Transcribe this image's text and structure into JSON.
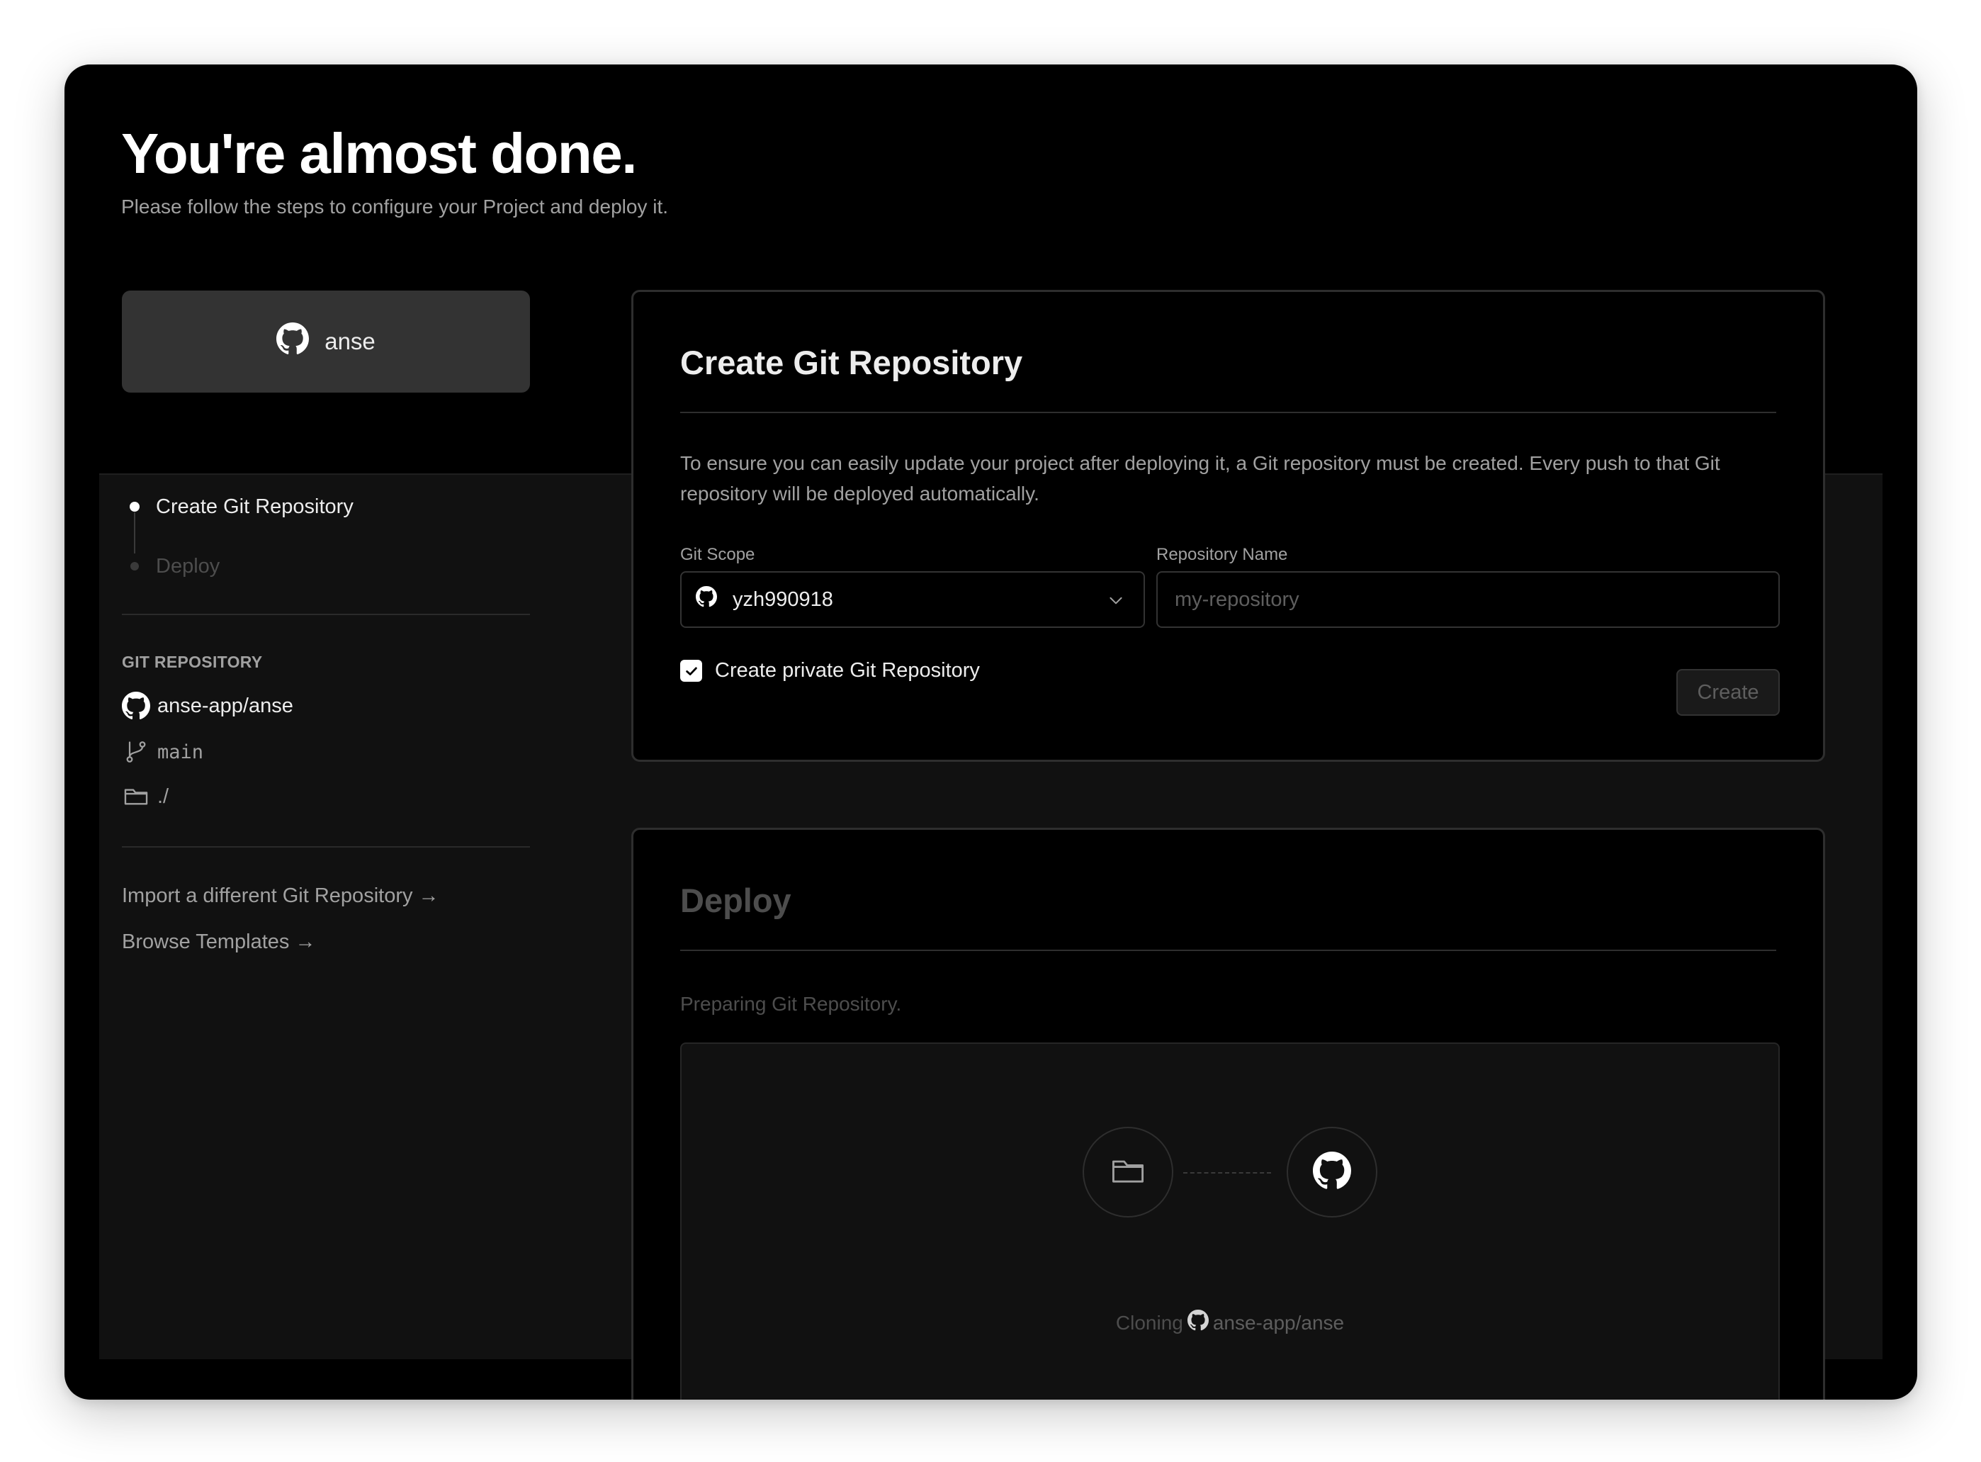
{
  "header": {
    "title": "You're almost done.",
    "subtitle": "Please follow the steps to configure your Project and deploy it."
  },
  "repo_chip": {
    "label": "anse",
    "icon": "github-icon"
  },
  "steps": [
    {
      "label": "Create Git Repository",
      "state": "active"
    },
    {
      "label": "Deploy",
      "state": "inactive"
    }
  ],
  "git_repository": {
    "section_label": "GIT REPOSITORY",
    "name": "anse-app/anse",
    "branch": "main",
    "root_dir": "./"
  },
  "links": {
    "import_different": "Import a different Git Repository →",
    "browse_templates": "Browse Templates →"
  },
  "create_card": {
    "title": "Create Git Repository",
    "description": "To ensure you can easily update your project after deploying it, a Git repository must be created. Every push to that Git repository will be deployed automatically.",
    "git_scope_label": "Git Scope",
    "git_scope_value": "yzh990918",
    "repo_name_label": "Repository Name",
    "repo_name_placeholder": "my-repository",
    "repo_name_value": "",
    "private_checkbox_label": "Create private Git Repository",
    "private_checked": true,
    "create_button": "Create"
  },
  "deploy_card": {
    "title": "Deploy",
    "status": "Preparing Git Repository.",
    "cloning_label": "Cloning",
    "cloning_repo": "anse-app/anse"
  },
  "colors": {
    "background": "#000000",
    "panel": "#111111",
    "text_primary": "#ededed",
    "text_secondary": "#a1a1a1",
    "text_disabled": "#4d4d4d",
    "border": "#2e2e2e"
  }
}
